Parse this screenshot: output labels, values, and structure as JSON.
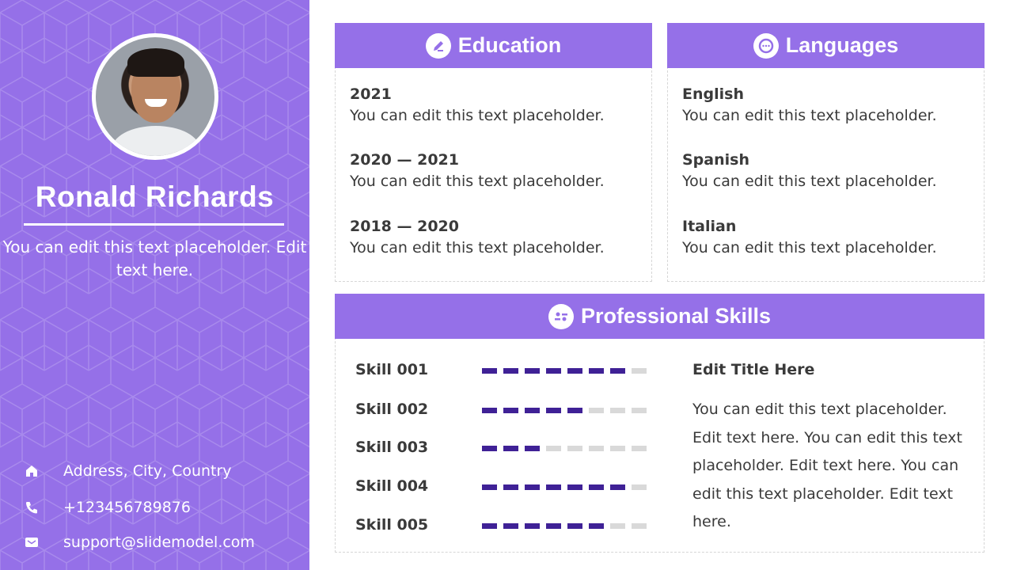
{
  "profile": {
    "name": "Ronald Richards",
    "bio": "You can edit this text placeholder. Edit text here.",
    "contact": [
      {
        "icon": "home-icon",
        "text": "Address, City, Country"
      },
      {
        "icon": "phone-icon",
        "text": "+123456789876"
      },
      {
        "icon": "mail-icon",
        "text": "support@slidemodel.com"
      }
    ]
  },
  "education": {
    "title": "Education",
    "icon": "pencil-icon",
    "entries": [
      {
        "title": "2021",
        "desc": "You can edit this text placeholder."
      },
      {
        "title": "2020 — 2021",
        "desc": "You can edit this text placeholder."
      },
      {
        "title": "2018 — 2020",
        "desc": "You can edit this text placeholder."
      }
    ]
  },
  "languages": {
    "title": "Languages",
    "icon": "chat-bubble-icon",
    "entries": [
      {
        "title": "English",
        "desc": "You can edit this text placeholder."
      },
      {
        "title": "Spanish",
        "desc": "You can edit this text placeholder."
      },
      {
        "title": "Italian",
        "desc": "You can edit this text placeholder."
      }
    ]
  },
  "skills": {
    "title": "Professional Skills",
    "icon": "skills-icon",
    "max_level": 8,
    "items": [
      {
        "label": "Skill 001",
        "level": 7
      },
      {
        "label": "Skill 002",
        "level": 5
      },
      {
        "label": "Skill 003",
        "level": 3
      },
      {
        "label": "Skill 004",
        "level": 7
      },
      {
        "label": "Skill 005",
        "level": 6
      }
    ],
    "side_title": "Edit Title Here",
    "side_text": "You can edit this text placeholder. Edit text here. You can edit this text placeholder. Edit text here. You can edit this text placeholder. Edit text here."
  },
  "colors": {
    "accent": "#9570e8",
    "bar_filled": "#3f2196",
    "bar_empty": "#d9d9d9"
  }
}
